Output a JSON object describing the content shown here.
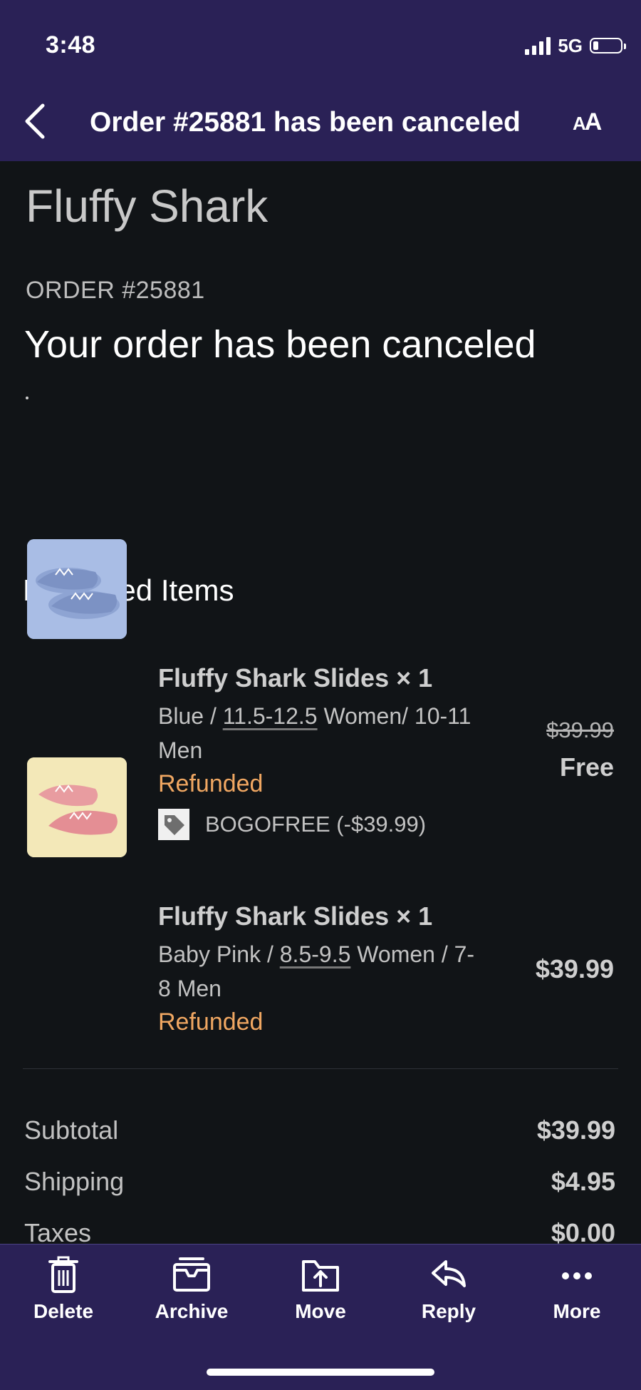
{
  "status_bar": {
    "time": "3:48",
    "network": "5G",
    "battery_level": 0.15
  },
  "header": {
    "title": "Order #25881 has been canceled"
  },
  "email": {
    "shop_name": "Fluffy Shark",
    "order_label": "ORDER #25881",
    "status_heading": "Your order has been canceled",
    "refunded_section_title": "Refunded Items",
    "items": [
      {
        "name": "Fluffy Shark Slides × 1",
        "color": "Blue",
        "sep1": " / ",
        "size_women": "11.5-12.5",
        "size_rest_line1": " Women/ 10-11",
        "size_rest_line2": "Men",
        "status": "Refunded",
        "discount": "BOGOFREE (-$39.99)",
        "original_price": "$39.99",
        "price": "Free"
      },
      {
        "name": "Fluffy Shark Slides × 1",
        "color": "Baby Pink",
        "sep1": " / ",
        "size_women": "8.5-9.5",
        "size_rest_line1": " Women / 7-",
        "size_rest_line2": "8 Men",
        "status": "Refunded",
        "price": "$39.99"
      }
    ],
    "summary": [
      {
        "label": "Subtotal",
        "value": "$39.99"
      },
      {
        "label": "Shipping",
        "value": "$4.95"
      },
      {
        "label": "Taxes",
        "value": "$0.00"
      }
    ]
  },
  "toolbar": {
    "delete": "Delete",
    "archive": "Archive",
    "move": "Move",
    "reply": "Reply",
    "more": "More"
  },
  "colors": {
    "header_bg": "#2a2156",
    "body_bg": "#111417",
    "refunded": "#f0a762"
  }
}
